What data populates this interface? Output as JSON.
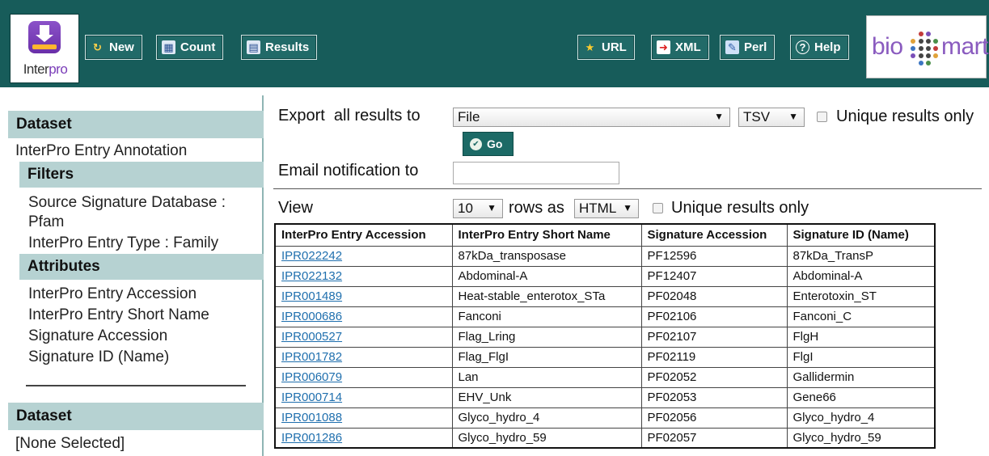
{
  "header": {
    "logo": {
      "inter": "Inter",
      "pro": "pro"
    },
    "buttons": {
      "new": "New",
      "count": "Count",
      "results": "Results",
      "url": "URL",
      "xml": "XML",
      "perl": "Perl",
      "help": "Help"
    },
    "biomart": {
      "bio": "bio",
      "mart": "mart"
    },
    "colors": {
      "bar": "#175c5a",
      "accent_purple": "#8a5bbf"
    }
  },
  "sidebar": {
    "dataset_heading": "Dataset",
    "dataset_name": "InterPro Entry Annotation",
    "filters_heading": "Filters",
    "filters": [
      "Source Signature Database :",
      "Pfam",
      "InterPro Entry Type : Family"
    ],
    "attributes_heading": "Attributes",
    "attributes": [
      "InterPro Entry Accession",
      "InterPro Entry Short Name",
      "Signature Accession",
      "Signature ID (Name)"
    ],
    "dataset2_heading": "Dataset",
    "dataset2_value": "[None Selected]"
  },
  "export": {
    "label": "Export  all results to",
    "destination": "File",
    "format": "TSV",
    "unique_label": "Unique results only",
    "go_label": "Go"
  },
  "email": {
    "label": "Email notification to",
    "value": ""
  },
  "view": {
    "label": "View",
    "rows": "10",
    "rows_as": "rows as",
    "format": "HTML",
    "unique_label": "Unique results only"
  },
  "table": {
    "headers": [
      "InterPro Entry Accession",
      "InterPro Entry Short Name",
      "Signature Accession",
      "Signature ID (Name)"
    ],
    "rows": [
      [
        "IPR022242",
        "87kDa_transposase",
        "PF12596",
        "87kDa_TransP"
      ],
      [
        "IPR022132",
        "Abdominal-A",
        "PF12407",
        "Abdominal-A"
      ],
      [
        "IPR001489",
        "Heat-stable_enterotox_STa",
        "PF02048",
        "Enterotoxin_ST"
      ],
      [
        "IPR000686",
        "Fanconi",
        "PF02106",
        "Fanconi_C"
      ],
      [
        "IPR000527",
        "Flag_Lring",
        "PF02107",
        "FlgH"
      ],
      [
        "IPR001782",
        "Flag_FlgI",
        "PF02119",
        "FlgI"
      ],
      [
        "IPR006079",
        "Lan",
        "PF02052",
        "Gallidermin"
      ],
      [
        "IPR000714",
        "EHV_Unk",
        "PF02053",
        "Gene66"
      ],
      [
        "IPR001088",
        "Glyco_hydro_4",
        "PF02056",
        "Glyco_hydro_4"
      ],
      [
        "IPR001286",
        "Glyco_hydro_59",
        "PF02057",
        "Glyco_hydro_59"
      ]
    ]
  }
}
